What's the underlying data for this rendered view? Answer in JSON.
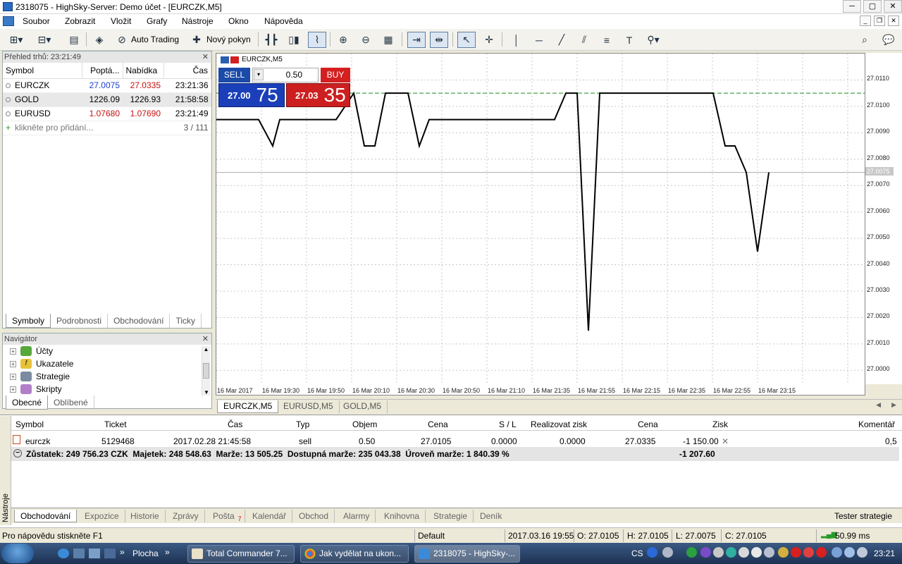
{
  "window": {
    "title": "2318075 - HighSky-Server: Demo účet - [EURCZK,M5]"
  },
  "menu": [
    "Soubor",
    "Zobrazit",
    "Vložit",
    "Grafy",
    "Nástroje",
    "Okno",
    "Nápověda"
  ],
  "toolbar": {
    "auto_trading": "Auto Trading",
    "new_order": "Nový pokyn"
  },
  "market_watch": {
    "header": "Přehled trhů: 23:21:49",
    "columns": [
      "Symbol",
      "Poptá...",
      "Nabídka",
      "Čas"
    ],
    "rows": [
      {
        "symbol": "EURCZK",
        "bid": "27.0075",
        "ask": "27.0335",
        "time": "23:21:36"
      },
      {
        "symbol": "GOLD",
        "bid": "1226.09",
        "ask": "1226.93",
        "time": "21:58:58"
      },
      {
        "symbol": "EURUSD",
        "bid": "1.07680",
        "ask": "1.07690",
        "time": "23:21:49"
      }
    ],
    "add_label": "klikněte pro přidání...",
    "count": "3 / 111",
    "tabs": [
      "Symboly",
      "Podrobnosti",
      "Obchodování",
      "Ticky"
    ]
  },
  "navigator": {
    "header": "Navigátor",
    "items": [
      "Účty",
      "Ukazatele",
      "Strategie",
      "Skripty"
    ],
    "tabs": [
      "Obecné",
      "Oblíbené"
    ]
  },
  "chart": {
    "label": "EURCZK,M5",
    "sell_label": "SELL",
    "buy_label": "BUY",
    "volume": "0.50",
    "sell_small": "27.00",
    "sell_large": "75",
    "buy_small": "27.03",
    "buy_large": "35",
    "current_price": "27.0075",
    "tabs": [
      "EURCZK,M5",
      "EURUSD,M5",
      "GOLD,M5"
    ]
  },
  "chart_data": {
    "type": "line",
    "x": [
      "16 Mar 2017",
      "16 Mar 19:30",
      "16 Mar 19:50",
      "16 Mar 20:10",
      "16 Mar 20:30",
      "16 Mar 20:50",
      "16 Mar 21:10",
      "16 Mar 21:35",
      "16 Mar 21:55",
      "16 Mar 22:15",
      "16 Mar 22:35",
      "16 Mar 22:55",
      "16 Mar 23:15"
    ],
    "y_ticks": [
      "27.0110",
      "27.0100",
      "27.0090",
      "27.0080",
      "27.0070",
      "27.0060",
      "27.0050",
      "27.0040",
      "27.0030",
      "27.0020",
      "27.0010",
      "27.0000"
    ],
    "ylim": [
      26.9995,
      27.012
    ],
    "ask_line": 27.0105,
    "bid_line": 27.0075,
    "series": [
      {
        "values": [
          [
            0,
            27.0095
          ],
          [
            60,
            27.0095
          ],
          [
            80,
            27.0085
          ],
          [
            90,
            27.0095
          ],
          [
            160,
            27.0095
          ],
          [
            170,
            27.0095
          ],
          [
            195,
            27.0105
          ],
          [
            210,
            27.0085
          ],
          [
            225,
            27.0085
          ],
          [
            240,
            27.0105
          ],
          [
            272,
            27.0105
          ],
          [
            288,
            27.0085
          ],
          [
            302,
            27.0095
          ],
          [
            480,
            27.0095
          ],
          [
            496,
            27.0105
          ],
          [
            512,
            27.0105
          ],
          [
            528,
            27.0015
          ],
          [
            544,
            27.0105
          ],
          [
            705,
            27.0105
          ],
          [
            722,
            27.0085
          ],
          [
            736,
            27.0085
          ],
          [
            752,
            27.0075
          ],
          [
            768,
            27.0045
          ],
          [
            784,
            27.0075
          ]
        ]
      }
    ]
  },
  "terminal": {
    "side_label": "Nástroje",
    "columns": [
      "Symbol",
      "Ticket",
      "Čas",
      "Typ",
      "Objem",
      "Cena",
      "S / L",
      "Realizovat zisk",
      "Cena",
      "Zisk",
      "Komentář"
    ],
    "row": {
      "symbol": "eurczk",
      "ticket": "5129468",
      "time": "2017.02.28 21:45:58",
      "type": "sell",
      "volume": "0.50",
      "price": "27.0105",
      "sl": "0.0000",
      "tp": "0.0000",
      "cur_price": "27.0335",
      "profit": "-1 150.00",
      "comment": "0,5"
    },
    "balance": "Zůstatek: 249 756.23 CZK  Majetek: 248 548.63  Marže: 13 505.25  Dostupná marže: 235 043.38  Úroveň marže: 1 840.39 %",
    "balance_total": "-1 207.60",
    "tabs": [
      "Obchodování",
      "Expozice",
      "Historie",
      "Zprávy",
      "Pošta",
      "Kalendář",
      "Obchod",
      "Alarmy",
      "Knihovna",
      "Strategie",
      "Deník"
    ],
    "mail_count": "7",
    "tester": "Tester strategie"
  },
  "statusbar": {
    "help": "Pro nápovědu stiskněte F1",
    "profile": "Default",
    "datetime": "2017.03.16 19:55",
    "open": "O: 27.0105",
    "high": "H: 27.0105",
    "low": "L: 27.0075",
    "close": "C: 27.0105",
    "ping": "50.99 ms"
  },
  "taskbar": {
    "items": [
      "Plocha",
      "Total Commander 7...",
      "Jak vydělat na ukon...",
      "2318075 - HighSky-..."
    ],
    "lang": "CS",
    "clock": "23:21"
  },
  "colors": {
    "bid_blue": "#1a3fd0",
    "ask_red": "#c81010",
    "sell_blue": "#1b4aa8",
    "buy_red": "#d42020",
    "ask_line_green": "#1f8a1f"
  }
}
